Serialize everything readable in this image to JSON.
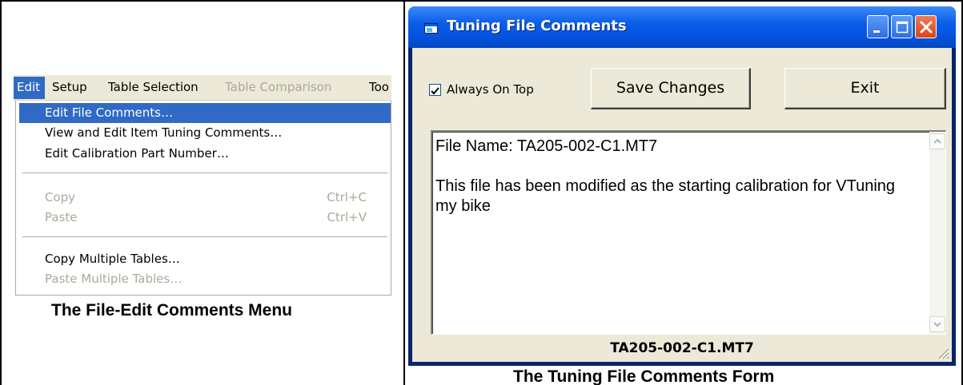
{
  "left_panel": {
    "menubar": {
      "items": [
        {
          "label": "Edit",
          "state": "active"
        },
        {
          "label": "Setup",
          "state": "normal"
        },
        {
          "label": "Table Selection",
          "state": "normal"
        },
        {
          "label": "Table Comparison",
          "state": "disabled"
        },
        {
          "label": "Too",
          "state": "normal"
        }
      ]
    },
    "edit_menu": {
      "items": [
        {
          "label": "Edit File Comments…",
          "shortcut": "",
          "state": "selected"
        },
        {
          "label": "View and Edit Item Tuning Comments…",
          "shortcut": "",
          "state": "normal"
        },
        {
          "label": "Edit Calibration Part Number…",
          "shortcut": "",
          "state": "normal"
        },
        {
          "label": "Copy",
          "shortcut": "Ctrl+C",
          "state": "disabled"
        },
        {
          "label": "Paste",
          "shortcut": "Ctrl+V",
          "state": "disabled"
        },
        {
          "label": "Copy Multiple Tables…",
          "shortcut": "",
          "state": "normal"
        },
        {
          "label": "Paste Multiple Tables…",
          "shortcut": "",
          "state": "disabled"
        }
      ]
    },
    "caption": "The File-Edit Comments Menu"
  },
  "right_panel": {
    "window": {
      "title": "Tuning File Comments",
      "icon": "app-window-icon",
      "controls": [
        "minimize-icon",
        "maximize-icon",
        "close-icon"
      ]
    },
    "always_on_top": {
      "label": "Always On Top",
      "checked": true
    },
    "buttons": {
      "save": "Save Changes",
      "exit": "Exit"
    },
    "comments": {
      "line1": "File Name: TA205-002-C1.MT7",
      "line2": "",
      "line3": "This file has been modified as the starting calibration for VTuning my bike"
    },
    "status_filename": "TA205-002-C1.MT7",
    "caption": "The Tuning File Comments Form"
  },
  "colors": {
    "menu_highlight": "#316ac5",
    "xp_face": "#ece9d8",
    "title_blue": "#0554e0",
    "close_red": "#d8441d",
    "disabled_text": "#aca899"
  }
}
